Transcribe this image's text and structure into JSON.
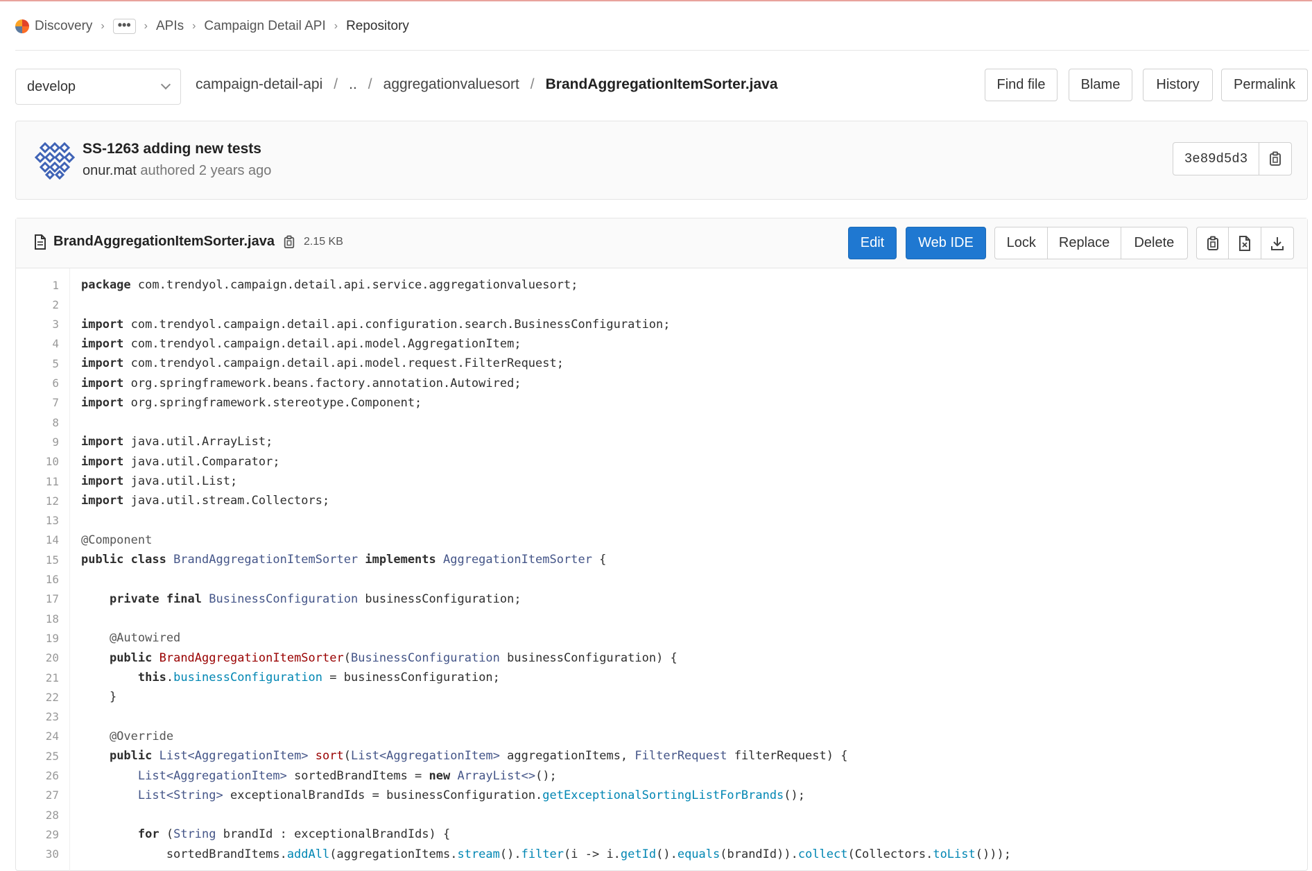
{
  "breadcrumb": {
    "items": [
      "Discovery",
      "•••",
      "APIs",
      "Campaign Detail API",
      "Repository"
    ]
  },
  "file_nav": {
    "branch": "develop",
    "path": [
      "campaign-detail-api",
      "..",
      "aggregationvaluesort"
    ],
    "file": "BrandAggregationItemSorter.java",
    "buttons": [
      "Find file",
      "Blame",
      "History",
      "Permalink"
    ]
  },
  "commit": {
    "title": "SS-1263 adding new tests",
    "author": "onur.mat",
    "meta": " authored 2 years ago",
    "sha": "3e89d5d3"
  },
  "file_header": {
    "name": "BrandAggregationItemSorter.java",
    "size": "2.15 KB",
    "edit": "Edit",
    "web_ide": "Web IDE",
    "lock": "Lock",
    "replace": "Replace",
    "delete": "Delete"
  },
  "icons": {
    "copy": "clipboard-icon",
    "raw": "file-raw-icon",
    "download": "download-icon",
    "file": "file-icon"
  },
  "colors": {
    "primary": "#1f78d1",
    "type": "#445588",
    "method": "#0086b3",
    "function_name": "#990000"
  },
  "code": [
    [
      [
        "k",
        "package"
      ],
      [
        "t",
        " com.trendyol.campaign.detail.api.service.aggregationvaluesort;"
      ]
    ],
    [],
    [
      [
        "k",
        "import"
      ],
      [
        "t",
        " com.trendyol.campaign.detail.api.configuration.search.BusinessConfiguration;"
      ]
    ],
    [
      [
        "k",
        "import"
      ],
      [
        "t",
        " com.trendyol.campaign.detail.api.model.AggregationItem;"
      ]
    ],
    [
      [
        "k",
        "import"
      ],
      [
        "t",
        " com.trendyol.campaign.detail.api.model.request.FilterRequest;"
      ]
    ],
    [
      [
        "k",
        "import"
      ],
      [
        "t",
        " org.springframework.beans.factory.annotation.Autowired;"
      ]
    ],
    [
      [
        "k",
        "import"
      ],
      [
        "t",
        " org.springframework.stereotype.Component;"
      ]
    ],
    [],
    [
      [
        "k",
        "import"
      ],
      [
        "t",
        " java.util.ArrayList;"
      ]
    ],
    [
      [
        "k",
        "import"
      ],
      [
        "t",
        " java.util.Comparator;"
      ]
    ],
    [
      [
        "k",
        "import"
      ],
      [
        "t",
        " java.util.List;"
      ]
    ],
    [
      [
        "k",
        "import"
      ],
      [
        "t",
        " java.util.stream.Collectors;"
      ]
    ],
    [],
    [
      [
        "a",
        "@Component"
      ]
    ],
    [
      [
        "k",
        "public class "
      ],
      [
        "y",
        "BrandAggregationItemSorter"
      ],
      [
        "k",
        " implements "
      ],
      [
        "y",
        "AggregationItemSorter"
      ],
      [
        "t",
        " {"
      ]
    ],
    [],
    [
      [
        "t",
        "    "
      ],
      [
        "k",
        "private final "
      ],
      [
        "y",
        "BusinessConfiguration"
      ],
      [
        "t",
        " businessConfiguration;"
      ]
    ],
    [],
    [
      [
        "a",
        "    @Autowired"
      ]
    ],
    [
      [
        "t",
        "    "
      ],
      [
        "k",
        "public "
      ],
      [
        "f",
        "BrandAggregationItemSorter"
      ],
      [
        "t",
        "("
      ],
      [
        "y",
        "BusinessConfiguration"
      ],
      [
        "t",
        " businessConfiguration) {"
      ]
    ],
    [
      [
        "t",
        "        "
      ],
      [
        "k",
        "this"
      ],
      [
        "t",
        "."
      ],
      [
        "m",
        "businessConfiguration"
      ],
      [
        "t",
        " = businessConfiguration;"
      ]
    ],
    [
      [
        "t",
        "    }"
      ]
    ],
    [],
    [
      [
        "a",
        "    @Override"
      ]
    ],
    [
      [
        "t",
        "    "
      ],
      [
        "k",
        "public "
      ],
      [
        "y",
        "List<AggregationItem>"
      ],
      [
        "t",
        " "
      ],
      [
        "f",
        "sort"
      ],
      [
        "t",
        "("
      ],
      [
        "y",
        "List<AggregationItem>"
      ],
      [
        "t",
        " aggregationItems, "
      ],
      [
        "y",
        "FilterRequest"
      ],
      [
        "t",
        " filterRequest) {"
      ]
    ],
    [
      [
        "t",
        "        "
      ],
      [
        "y",
        "List<AggregationItem>"
      ],
      [
        "t",
        " sortedBrandItems = "
      ],
      [
        "k",
        "new "
      ],
      [
        "y",
        "ArrayList<>"
      ],
      [
        "t",
        "();"
      ]
    ],
    [
      [
        "t",
        "        "
      ],
      [
        "y",
        "List<String>"
      ],
      [
        "t",
        " exceptionalBrandIds = businessConfiguration."
      ],
      [
        "m",
        "getExceptionalSortingListForBrands"
      ],
      [
        "t",
        "();"
      ]
    ],
    [],
    [
      [
        "t",
        "        "
      ],
      [
        "k",
        "for "
      ],
      [
        "t",
        "("
      ],
      [
        "y",
        "String"
      ],
      [
        "t",
        " brandId : exceptionalBrandIds) {"
      ]
    ],
    [
      [
        "t",
        "            sortedBrandItems."
      ],
      [
        "m",
        "addAll"
      ],
      [
        "t",
        "(aggregationItems."
      ],
      [
        "m",
        "stream"
      ],
      [
        "t",
        "()."
      ],
      [
        "m",
        "filter"
      ],
      [
        "t",
        "(i -> i."
      ],
      [
        "m",
        "getId"
      ],
      [
        "t",
        "()."
      ],
      [
        "m",
        "equals"
      ],
      [
        "t",
        "(brandId))."
      ],
      [
        "m",
        "collect"
      ],
      [
        "t",
        "(Collectors."
      ],
      [
        "m",
        "toList"
      ],
      [
        "t",
        "()));"
      ]
    ]
  ]
}
